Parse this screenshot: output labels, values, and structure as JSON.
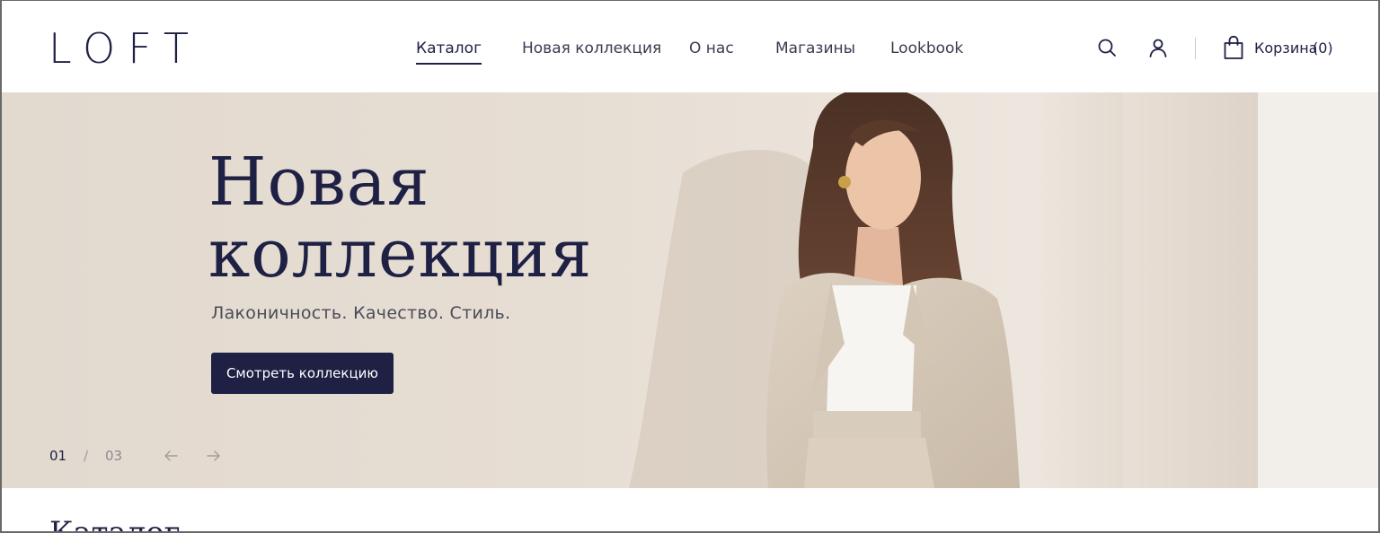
{
  "header": {
    "logo": "LOFT",
    "nav": [
      {
        "label": "Каталог",
        "active": true
      },
      {
        "label": "Новая коллекция",
        "active": false
      },
      {
        "label": "О нас",
        "active": false
      },
      {
        "label": "Магазины",
        "active": false
      },
      {
        "label": "Lookbook",
        "active": false
      }
    ],
    "icons": {
      "search": "search-icon",
      "account": "user-icon",
      "cart": "shopping-bag-icon"
    },
    "cart_label": "Корзина",
    "cart_count": "(0)"
  },
  "hero": {
    "title_line1": "Новая",
    "title_line2": "коллекция",
    "subtitle": "Лаконичность. Качество. Стиль.",
    "button_label": "Смотреть коллекцию",
    "pager_current": "01",
    "pager_separator": "/",
    "pager_total": "03",
    "photo": "model-in-beige-suit"
  },
  "section": {
    "title": "Каталог"
  },
  "colors": {
    "brand": "#1e2044",
    "hero_bg": "#e6ddd3",
    "text_muted": "#4a4b59"
  }
}
